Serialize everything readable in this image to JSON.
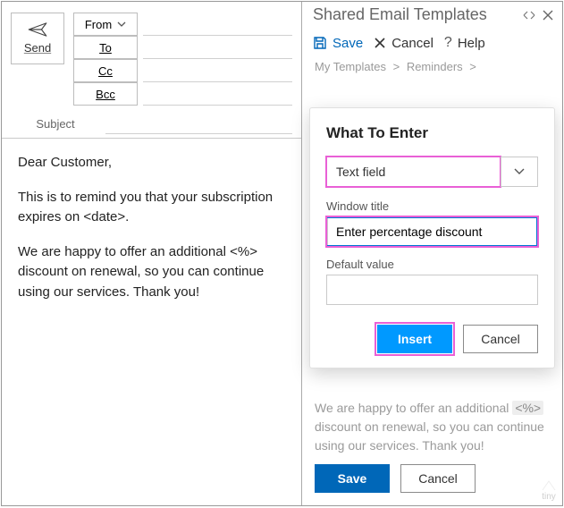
{
  "compose": {
    "send_label": "Send",
    "from_label": "From",
    "to_label": "To",
    "cc_label": "Cc",
    "bcc_label": "Bcc",
    "subject_label": "Subject",
    "body_greeting": "Dear Customer,",
    "body_p1": "This is to remind you that your subscription expires on <date>.",
    "body_p2": "We are happy to offer an additional <%> discount on renewal, so you can continue using our services. Thank you!"
  },
  "pane": {
    "title": "Shared Email Templates",
    "save_label": "Save",
    "cancel_label": "Cancel",
    "help_label": "Help",
    "crumb1": "My Templates",
    "crumb2": "Reminders",
    "crumb_sep": ">",
    "preview_line_a": "We are happy to offer an additional ",
    "preview_tag": "<%>",
    "preview_line_b": " discount on renewal, so you can continue using our services. Thank you!",
    "footer_save": "Save",
    "footer_cancel": "Cancel"
  },
  "dialog": {
    "title": "What To Enter",
    "type_value": "Text field",
    "window_title_label": "Window title",
    "window_title_value": "Enter percentage discount",
    "default_value_label": "Default value",
    "default_value_value": "",
    "insert_label": "Insert",
    "cancel_label": "Cancel"
  },
  "watermark": "tiny"
}
